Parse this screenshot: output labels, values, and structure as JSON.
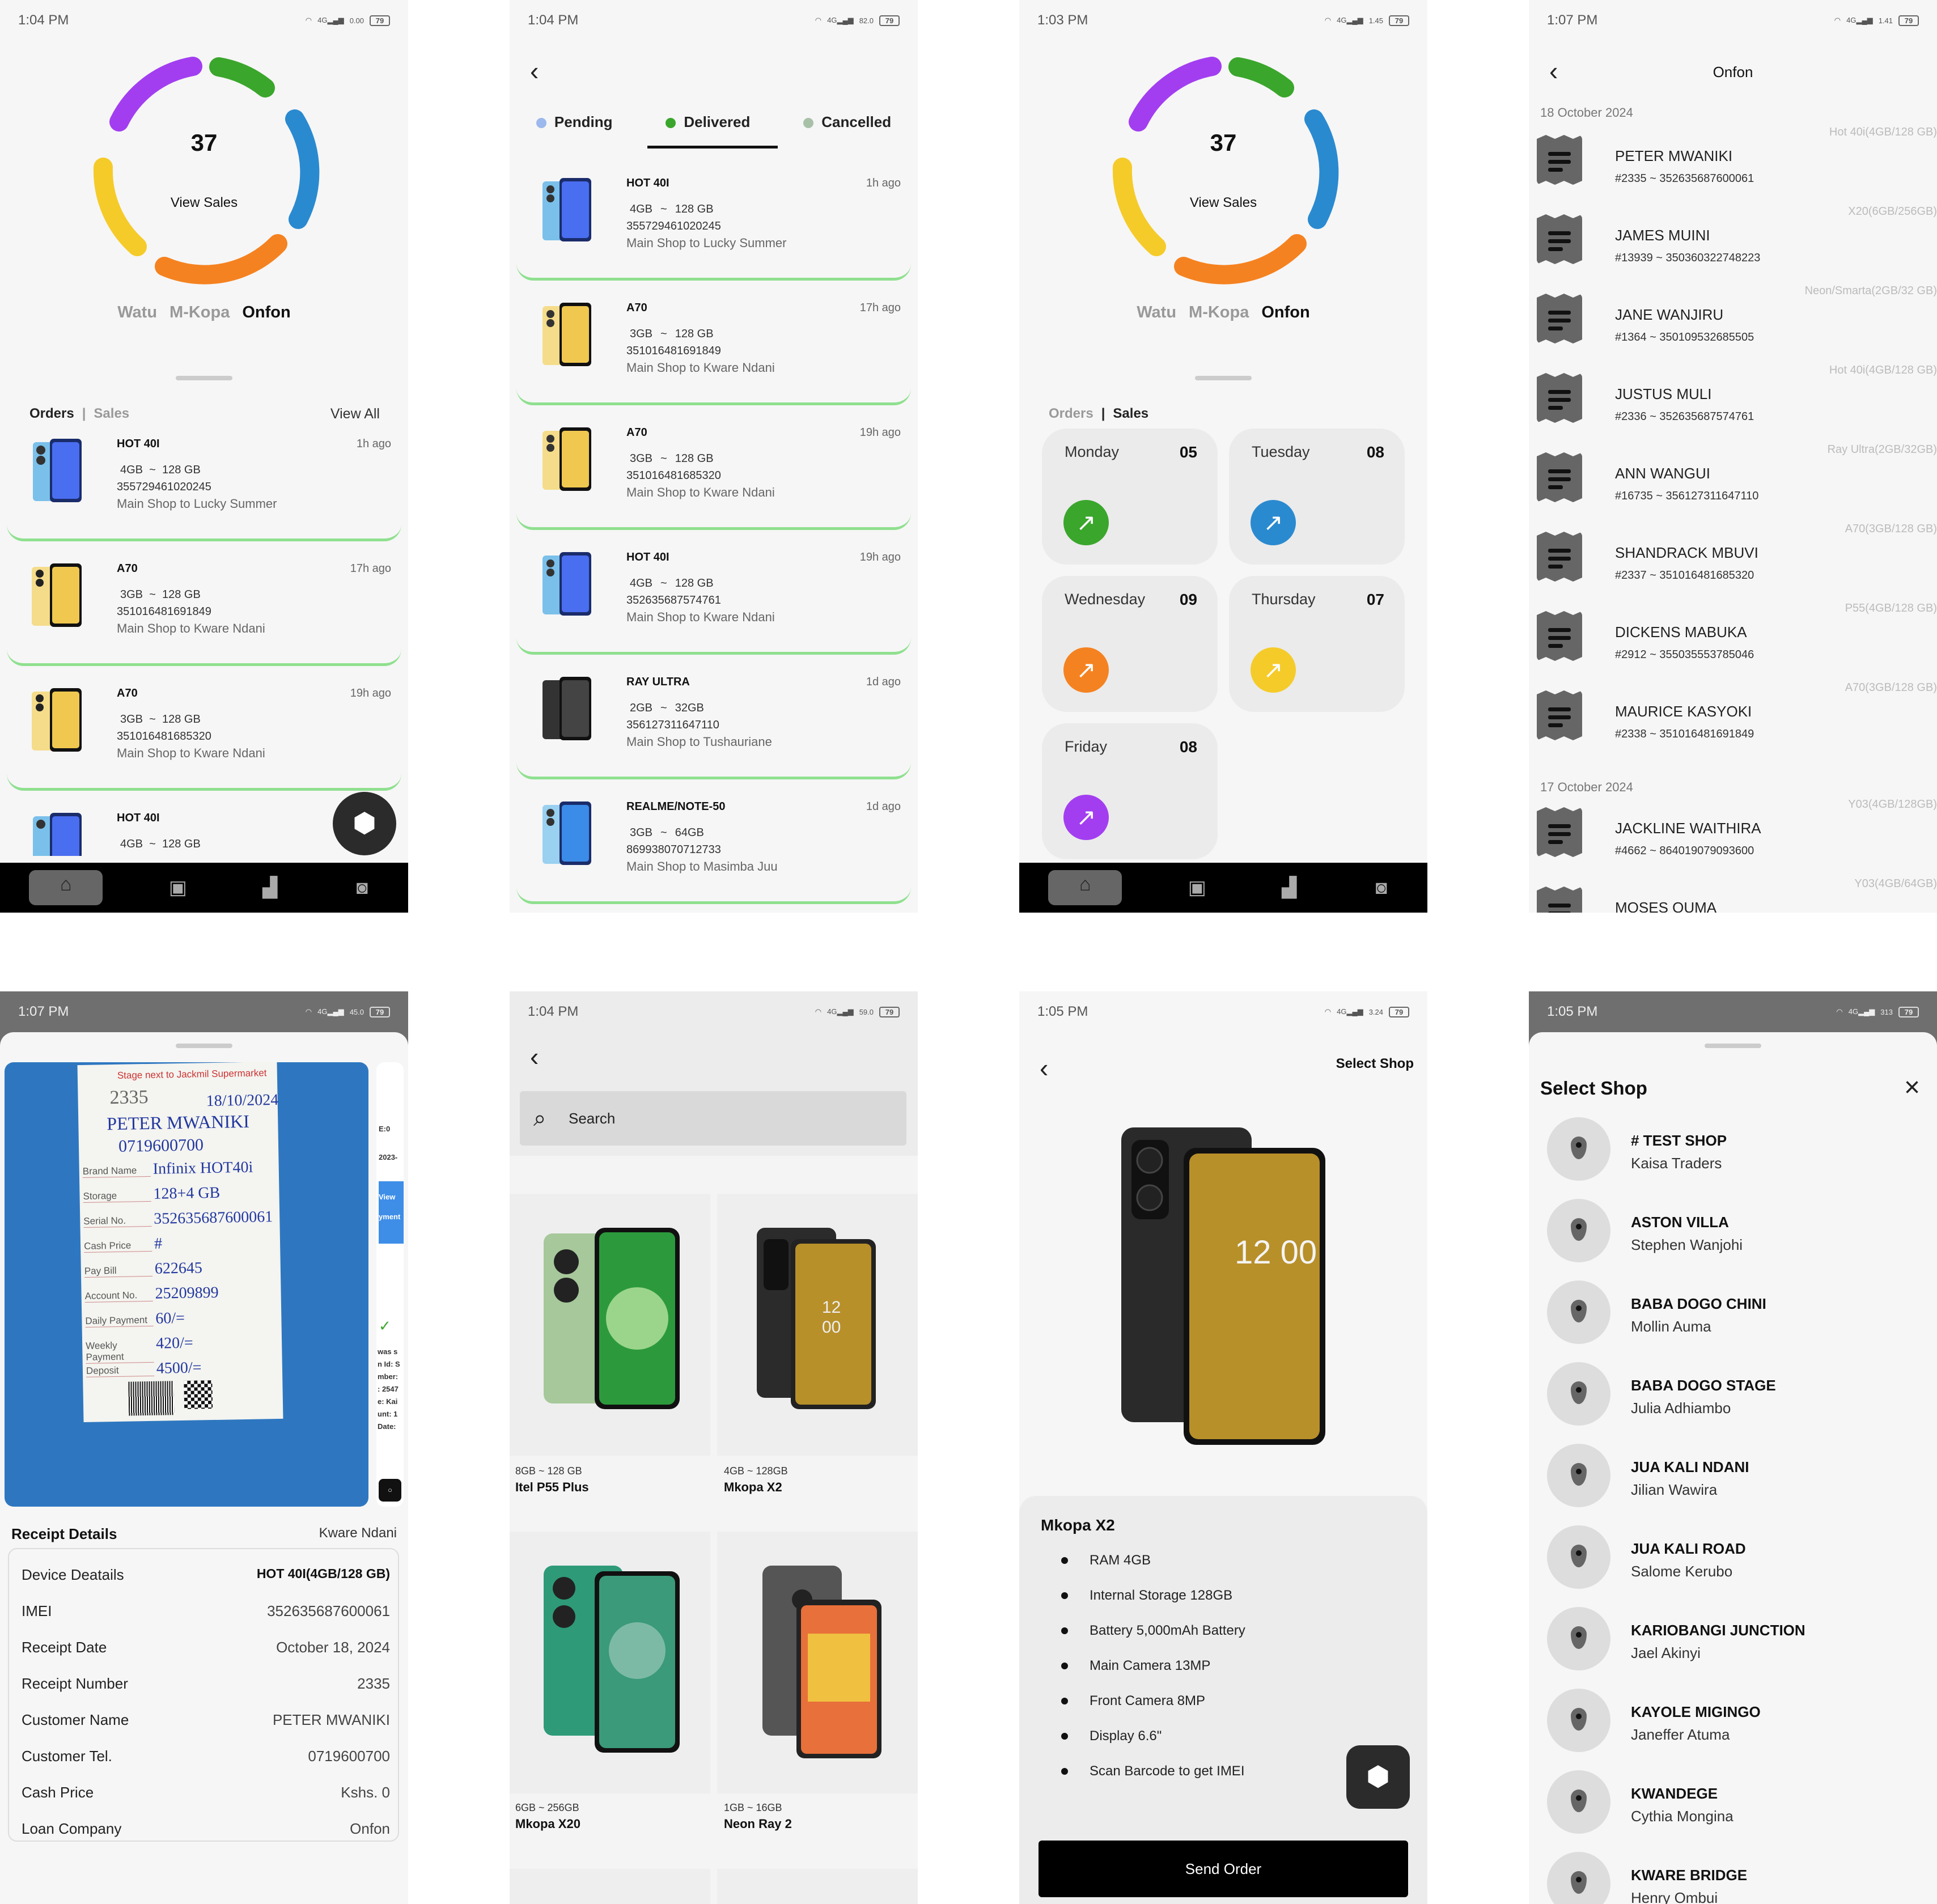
{
  "status": {
    "s1": {
      "time": "1:04 PM",
      "speed": "0.00",
      "batt": "79"
    },
    "s2": {
      "time": "1:04 PM",
      "speed": "82.0",
      "batt": "79"
    },
    "s3": {
      "time": "1:03 PM",
      "speed": "1.45",
      "batt": "79"
    },
    "s4": {
      "time": "1:07 PM",
      "speed": "1.41",
      "batt": "79"
    },
    "s5": {
      "time": "1:07 PM",
      "speed": "45.0",
      "batt": "79"
    },
    "s6": {
      "time": "1:04 PM",
      "speed": "59.0",
      "batt": "79"
    },
    "s7": {
      "time": "1:05 PM",
      "speed": "3.24",
      "batt": "79"
    },
    "s8": {
      "time": "1:05 PM",
      "speed": "313",
      "batt": "79"
    }
  },
  "dashboard": {
    "total": "37",
    "view_sales": "View Sales",
    "companies": [
      "Watu",
      "M-Kopa",
      "Onfon"
    ],
    "ring_colors": [
      "#a23ef0",
      "#3aa62c",
      "#2a8ad0",
      "#f58220",
      "#f5cb2a"
    ]
  },
  "orders_tabs": {
    "orders": "Orders",
    "sep": "|",
    "sales": "Sales",
    "view_all": "View All"
  },
  "orders": [
    {
      "model": "HOT 40I",
      "ago": "1h ago",
      "ram": "4GB",
      "sep": "~",
      "storage": "128 GB",
      "imei": "355729461020245",
      "route": "Main Shop to Lucky Summer"
    },
    {
      "model": "A70",
      "ago": "17h ago",
      "ram": "3GB",
      "sep": "~",
      "storage": "128 GB",
      "imei": "351016481691849",
      "route": "Main Shop to Kware Ndani"
    },
    {
      "model": "A70",
      "ago": "19h ago",
      "ram": "3GB",
      "sep": "~",
      "storage": "128 GB",
      "imei": "351016481685320",
      "route": "Main Shop to Kware Ndani"
    },
    {
      "model": "HOT 40I",
      "ago": "",
      "ram": "4GB",
      "sep": "~",
      "storage": "128 GB",
      "imei": "",
      "route": ""
    }
  ],
  "delivery_tabs": {
    "pending": "Pending",
    "delivered": "Delivered",
    "cancelled": "Cancelled"
  },
  "deliveries": [
    {
      "model": "HOT 40I",
      "ago": "1h ago",
      "ram": "4GB",
      "sep": "~",
      "storage": "128 GB",
      "imei": "355729461020245",
      "route": "Main Shop to Lucky Summer"
    },
    {
      "model": "A70",
      "ago": "17h ago",
      "ram": "3GB",
      "sep": "~",
      "storage": "128 GB",
      "imei": "351016481691849",
      "route": "Main Shop to Kware Ndani"
    },
    {
      "model": "A70",
      "ago": "19h ago",
      "ram": "3GB",
      "sep": "~",
      "storage": "128 GB",
      "imei": "351016481685320",
      "route": "Main Shop to Kware Ndani"
    },
    {
      "model": "HOT 40I",
      "ago": "19h ago",
      "ram": "4GB",
      "sep": "~",
      "storage": "128 GB",
      "imei": "352635687574761",
      "route": "Main Shop to Kware Ndani"
    },
    {
      "model": "RAY ULTRA",
      "ago": "1d ago",
      "ram": "2GB",
      "sep": "~",
      "storage": "32GB",
      "imei": "356127311647110",
      "route": "Main Shop to Tushauriane"
    },
    {
      "model": "REALME/NOTE-50",
      "ago": "1d ago",
      "ram": "3GB",
      "sep": "~",
      "storage": "64GB",
      "imei": "869938070712733",
      "route": "Main Shop to Masimba Juu"
    }
  ],
  "sales_days": [
    {
      "day": "Monday",
      "count": "05",
      "color": "#3aa62c"
    },
    {
      "day": "Tuesday",
      "count": "08",
      "color": "#2a8ad0"
    },
    {
      "day": "Wednesday",
      "count": "09",
      "color": "#f58220"
    },
    {
      "day": "Thursday",
      "count": "07",
      "color": "#f5cb2a"
    },
    {
      "day": "Friday",
      "count": "08",
      "color": "#a23ef0"
    }
  ],
  "sales_list": {
    "title": "Onfon",
    "date1": "18 October 2024",
    "date2": "17 October 2024",
    "rows": [
      {
        "name": "PETER MWANIKI",
        "ref": "#2335 ~ 352635687600061",
        "model": "Hot 40i(4GB/128 GB)"
      },
      {
        "name": "JAMES MUINI",
        "ref": "#13939 ~ 350360322748223",
        "model": "X20(6GB/256GB)"
      },
      {
        "name": "JANE WANJIRU",
        "ref": "#1364 ~ 350109532685505",
        "model": "Neon/Smarta(2GB/32 GB)"
      },
      {
        "name": "JUSTUS MULI",
        "ref": "#2336 ~ 352635687574761",
        "model": "Hot 40i(4GB/128 GB)"
      },
      {
        "name": "ANN WANGUI",
        "ref": "#16735 ~ 356127311647110",
        "model": "Ray Ultra(2GB/32GB)"
      },
      {
        "name": "SHANDRACK MBUVI",
        "ref": "#2337 ~ 351016481685320",
        "model": "A70(3GB/128 GB)"
      },
      {
        "name": "DICKENS MABUKA",
        "ref": "#2912 ~ 355035553785046",
        "model": "P55(4GB/128 GB)"
      },
      {
        "name": "MAURICE KASYOKI",
        "ref": "#2338 ~ 351016481691849",
        "model": "A70(3GB/128 GB)"
      },
      {
        "name": "JACKLINE WAITHIRA",
        "ref": "#4662 ~ 864019079093600",
        "model": "Y03(4GB/128GB)"
      },
      {
        "name": "MOSES OUMA",
        "ref": "",
        "model": "Y03(4GB/64GB)"
      }
    ]
  },
  "receipt": {
    "title": "Receipt Details",
    "shop": "Kware Ndani",
    "paper": {
      "top": "Stage next to Jackmil Supermarket",
      "no": "2335",
      "date": "18/10/2024",
      "name": "PETER MWANIKI",
      "tel": "0719600700",
      "labels": [
        "Brand Name",
        "Storage",
        "Serial No.",
        "Cash Price",
        "Pay Bill",
        "Account No.",
        "Daily Payment",
        "Weekly Payment",
        "Deposit"
      ],
      "values": [
        "Infinix HOT40i",
        "128+4 GB",
        "352635687600061",
        "#",
        "622645",
        "25209899",
        "60/=",
        "420/=",
        "4500/="
      ]
    },
    "side": {
      "l1": "E:0",
      "l2": "2023-",
      "l3": "View",
      "l4": "yment",
      "l5": "was s",
      "l6": "n Id: S",
      "l7": "mber:",
      "l8": ": 2547",
      "l9": "e: Kai",
      "l10": "unt: 1",
      "l11": "Date:"
    },
    "rows": [
      {
        "k": "Device Deatails",
        "v": "HOT 40I(4GB/128 GB)"
      },
      {
        "k": "IMEI",
        "v": "352635687600061"
      },
      {
        "k": "Receipt Date",
        "v": "October 18, 2024"
      },
      {
        "k": "Receipt Number",
        "v": "2335"
      },
      {
        "k": "Customer Name",
        "v": "PETER MWANIKI"
      },
      {
        "k": "Customer Tel.",
        "v": "0719600700"
      },
      {
        "k": "Cash Price",
        "v": "Kshs. 0"
      },
      {
        "k": "Loan Company",
        "v": "Onfon"
      }
    ]
  },
  "catalog": {
    "search": "Search",
    "products": [
      {
        "spec": "8GB ~ 128 GB",
        "name": "Itel P55 Plus"
      },
      {
        "spec": "4GB ~ 128GB",
        "name": "Mkopa X2"
      },
      {
        "spec": "6GB ~ 256GB",
        "name": "Mkopa X20"
      },
      {
        "spec": "1GB ~ 16GB",
        "name": "Neon Ray 2"
      }
    ]
  },
  "product": {
    "header": "Select Shop",
    "name": "Mkopa X2",
    "phone_time": "12 00",
    "specs": [
      "RAM 4GB",
      "Internal Storage 128GB",
      "Battery 5,000mAh Battery",
      "Main Camera 13MP",
      "Front Camera 8MP",
      "Display 6.6\"",
      "Scan Barcode to get IMEI"
    ],
    "send": "Send Order"
  },
  "shops": {
    "title": "Select Shop",
    "list": [
      {
        "name": "# TEST SHOP",
        "owner": "Kaisa Traders"
      },
      {
        "name": "ASTON VILLA",
        "owner": "Stephen Wanjohi"
      },
      {
        "name": "BABA DOGO CHINI",
        "owner": "Mollin Auma"
      },
      {
        "name": "BABA DOGO STAGE",
        "owner": "Julia Adhiambo"
      },
      {
        "name": "JUA KALI NDANI",
        "owner": "Jilian Wawira"
      },
      {
        "name": "JUA KALI ROAD",
        "owner": "Salome Kerubo"
      },
      {
        "name": "KARIOBANGI JUNCTION",
        "owner": "Jael Akinyi"
      },
      {
        "name": "KAYOLE MIGINGO",
        "owner": "Janeffer Atuma"
      },
      {
        "name": "KWANDEGE",
        "owner": "Cythia Mongina"
      },
      {
        "name": "KWARE BRIDGE",
        "owner": "Henry Ombui"
      }
    ]
  },
  "icons": {
    "back": "back-arrow-icon",
    "fab": "box-scan-icon",
    "nav": [
      "home-icon",
      "box-icon",
      "chart-icon",
      "profile-icon"
    ]
  }
}
